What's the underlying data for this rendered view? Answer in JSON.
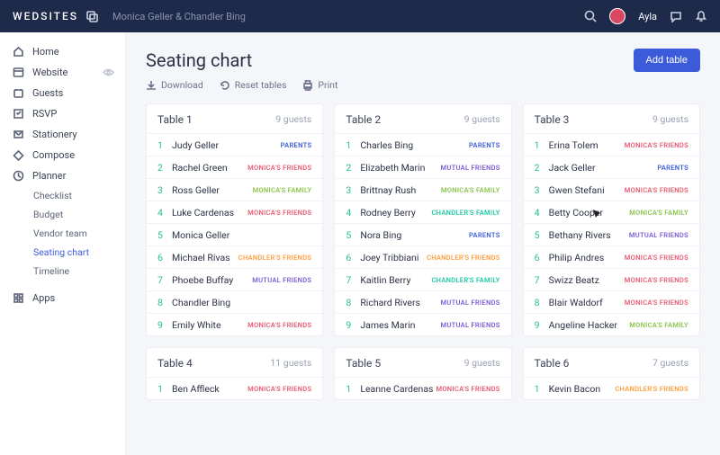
{
  "brand": "WEDSITES",
  "event_name": "Monica Geller & Chandler Bing",
  "user_name": "Ayla",
  "nav": [
    {
      "label": "Home"
    },
    {
      "label": "Website"
    },
    {
      "label": "Guests"
    },
    {
      "label": "RSVP"
    },
    {
      "label": "Stationery"
    },
    {
      "label": "Compose"
    },
    {
      "label": "Planner"
    }
  ],
  "planner_sub": [
    {
      "label": "Checklist"
    },
    {
      "label": "Budget"
    },
    {
      "label": "Vendor team"
    },
    {
      "label": "Seating chart",
      "active": true
    },
    {
      "label": "Timeline"
    }
  ],
  "apps_label": "Apps",
  "page_title": "Seating chart",
  "add_button": "Add table",
  "tools": {
    "download": "Download",
    "reset": "Reset tables",
    "print": "Print"
  },
  "tag_colors": {
    "PARENTS": "#3b5bdb",
    "MONICA'S FRIENDS": "#e85a71",
    "MONICA'S FAMILY": "#8bc34a",
    "CHANDLER'S FRIENDS": "#ff9d3b",
    "CHANDLER'S FAMILY": "#1ec9a4",
    "MUTUAL FRIENDS": "#7b5bd6"
  },
  "tables": [
    {
      "name": "Table 1",
      "count": "9 guests",
      "guests": [
        {
          "n": "1",
          "name": "Judy Geller",
          "tag": "PARENTS"
        },
        {
          "n": "2",
          "name": "Rachel Green",
          "tag": "MONICA'S FRIENDS"
        },
        {
          "n": "3",
          "name": "Ross Geller",
          "tag": "MONICA'S FAMILY"
        },
        {
          "n": "4",
          "name": "Luke Cardenas",
          "tag": "MONICA'S FRIENDS"
        },
        {
          "n": "5",
          "name": "Monica Geller",
          "tag": ""
        },
        {
          "n": "6",
          "name": "Michael Rivas",
          "tag": "CHANDLER'S FRIENDS"
        },
        {
          "n": "7",
          "name": "Phoebe Buffay",
          "tag": "MUTUAL FRIENDS"
        },
        {
          "n": "8",
          "name": "Chandler Bing",
          "tag": ""
        },
        {
          "n": "9",
          "name": "Emily White",
          "tag": "MONICA'S FRIENDS"
        }
      ]
    },
    {
      "name": "Table 2",
      "count": "9 guests",
      "guests": [
        {
          "n": "1",
          "name": "Charles Bing",
          "tag": "PARENTS"
        },
        {
          "n": "2",
          "name": "Elizabeth Marin",
          "tag": "MUTUAL FRIENDS"
        },
        {
          "n": "3",
          "name": "Brittnay Rush",
          "tag": "MONICA'S FAMILY"
        },
        {
          "n": "4",
          "name": "Rodney Berry",
          "tag": "CHANDLER'S FAMILY"
        },
        {
          "n": "5",
          "name": "Nora Bing",
          "tag": "PARENTS"
        },
        {
          "n": "6",
          "name": "Joey Tribbiani",
          "tag": "CHANDLER'S FRIENDS"
        },
        {
          "n": "7",
          "name": "Kaitlin Berry",
          "tag": "CHANDLER'S FAMILY"
        },
        {
          "n": "8",
          "name": "Richard Rivers",
          "tag": "MUTUAL FRIENDS"
        },
        {
          "n": "9",
          "name": "James Marin",
          "tag": "MUTUAL FRIENDS"
        }
      ]
    },
    {
      "name": "Table 3",
      "count": "9 guests",
      "guests": [
        {
          "n": "1",
          "name": "Erina Tolem",
          "tag": "MONICA'S FRIENDS"
        },
        {
          "n": "2",
          "name": "Jack Geller",
          "tag": "PARENTS"
        },
        {
          "n": "3",
          "name": "Gwen Stefani",
          "tag": "MONICA'S FRIENDS"
        },
        {
          "n": "4",
          "name": "Betty Cooper",
          "tag": "MONICA'S FAMILY",
          "cursor": true
        },
        {
          "n": "5",
          "name": "Bethany Rivers",
          "tag": "MUTUAL FRIENDS"
        },
        {
          "n": "6",
          "name": "Philip Andres",
          "tag": "MONICA'S FRIENDS"
        },
        {
          "n": "7",
          "name": "Swizz Beatz",
          "tag": "MONICA'S FRIENDS"
        },
        {
          "n": "8",
          "name": "Blair Waldorf",
          "tag": "MONICA'S FRIENDS"
        },
        {
          "n": "9",
          "name": "Angeline Hacker",
          "tag": "MONICA'S FAMILY"
        }
      ]
    },
    {
      "name": "Table 4",
      "count": "11 guests",
      "guests": [
        {
          "n": "1",
          "name": "Ben Affleck",
          "tag": "MONICA'S FRIENDS"
        }
      ]
    },
    {
      "name": "Table 5",
      "count": "9 guests",
      "guests": [
        {
          "n": "1",
          "name": "Leanne Cardenas",
          "tag": "MONICA'S FRIENDS"
        }
      ]
    },
    {
      "name": "Table 6",
      "count": "7 guests",
      "guests": [
        {
          "n": "1",
          "name": "Kevin Bacon",
          "tag": "CHANDLER'S FRIENDS"
        }
      ]
    }
  ]
}
